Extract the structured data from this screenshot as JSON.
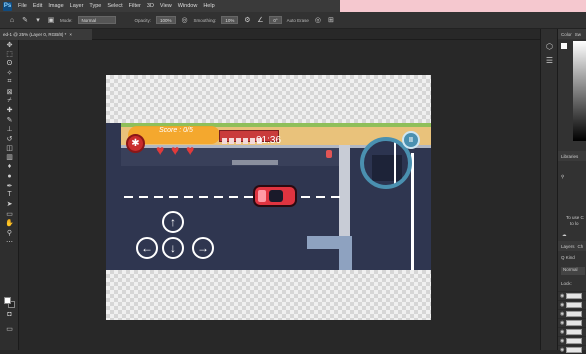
{
  "app": {
    "logo": "Ps"
  },
  "menubar": {
    "items": [
      "File",
      "Edit",
      "Image",
      "Layer",
      "Type",
      "Select",
      "Filter",
      "3D",
      "View",
      "Window",
      "Help"
    ]
  },
  "options": {
    "mode_label": "Mode:",
    "mode_value": "Normal",
    "opacity_label": "Opacity:",
    "opacity_value": "100%",
    "smoothing_label": "Smoothing:",
    "smoothing_value": "10%",
    "angle_value": "0°",
    "autoerase_label": "Auto Erase"
  },
  "document_tab": {
    "title": "ed-1 @ 25% (Layer 0, RGB/8) *",
    "close": "×"
  },
  "game": {
    "score": "Score : 0/5",
    "timer": "01:36",
    "pause": "II",
    "arrows": {
      "up": "↑",
      "left": "←",
      "down": "↓",
      "right": "→"
    },
    "settings_glyph": "✱"
  },
  "right_icons": [
    "⬡",
    "☰"
  ],
  "panels": {
    "color_tab": "Color",
    "swatches_tab": "Sw",
    "libraries_label": "Libraries",
    "libraries_hint_1": "To use C",
    "libraries_hint_2": "to lo",
    "layers_tab": "Layers",
    "channels_tab": "Ch",
    "kind_label": "Q Kind",
    "blend_value": "Normal",
    "lock_label": "Lock:"
  },
  "colors": {
    "accent_pink": "#f5c8cf",
    "car": "#e03440",
    "road": "#2f3650",
    "minimap_ring": "#4a90b0"
  }
}
